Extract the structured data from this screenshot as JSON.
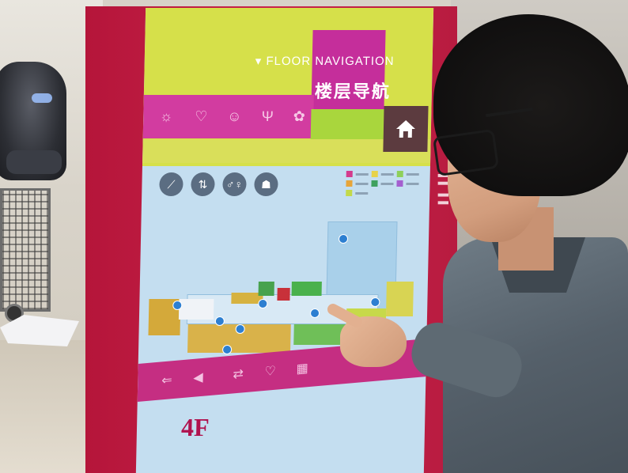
{
  "kiosk": {
    "title_en": "FLOOR NAVIGATION",
    "title_cn": "楼层导航",
    "floor": "4F",
    "colors": {
      "frame": "#c8234a",
      "tile_yellow": "#d6e04a",
      "tile_magenta": "#c52e9b",
      "tile_green": "#a9d63d",
      "home_tile": "#5c3b3f",
      "screen_bg": "#c4def0",
      "floor_label": "#b0124e"
    },
    "icons": {
      "home": "home-icon",
      "categories": [
        "bulb-icon",
        "heart-icon",
        "smile-icon",
        "food-icon",
        "gift-icon"
      ],
      "filters": [
        "escalator-icon",
        "elevator-icon",
        "restroom-icon",
        "person-icon"
      ],
      "bottom_bar": [
        "back-icon",
        "volume-icon",
        "share-icon",
        "heart-icon",
        "map-icon"
      ]
    }
  }
}
